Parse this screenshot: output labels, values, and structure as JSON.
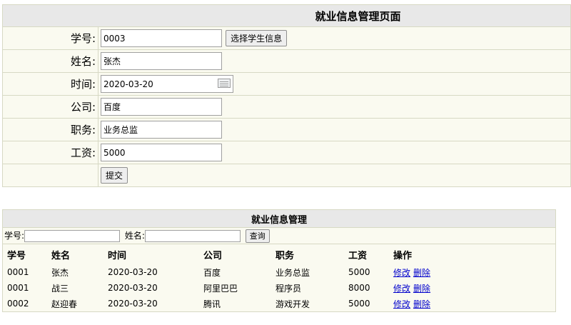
{
  "form": {
    "title": "就业信息管理页面",
    "fields": [
      {
        "label": "学号:",
        "value": "0003"
      },
      {
        "label": "姓名:",
        "value": "张杰"
      },
      {
        "label": "时间:",
        "value": "2020-03-20"
      },
      {
        "label": "公司:",
        "value": "百度"
      },
      {
        "label": "职务:",
        "value": "业务总监"
      },
      {
        "label": "工资:",
        "value": "5000"
      }
    ],
    "select_student_button": "选择学生信息",
    "submit_button": "提交"
  },
  "list": {
    "title": "就业信息管理",
    "search": {
      "id_label": "学号:",
      "id_value": "",
      "name_label": "姓名:",
      "name_value": "",
      "query_button": "查询"
    },
    "columns": [
      "学号",
      "姓名",
      "时间",
      "公司",
      "职务",
      "工资",
      "操作"
    ],
    "rows": [
      {
        "id": "0001",
        "name": "张杰",
        "date": "2020-03-20",
        "company": "百度",
        "position": "业务总监",
        "salary": "5000",
        "edit": "修改",
        "delete": "删除"
      },
      {
        "id": "0001",
        "name": "战三",
        "date": "2020-03-20",
        "company": "阿里巴巴",
        "position": "程序员",
        "salary": "8000",
        "edit": "修改",
        "delete": "删除"
      },
      {
        "id": "0002",
        "name": "赵迎春",
        "date": "2020-03-20",
        "company": "腾讯",
        "position": "游戏开发",
        "salary": "5000",
        "edit": "修改",
        "delete": "删除"
      }
    ]
  },
  "icons": {
    "date_picker": "calendar-icon"
  }
}
